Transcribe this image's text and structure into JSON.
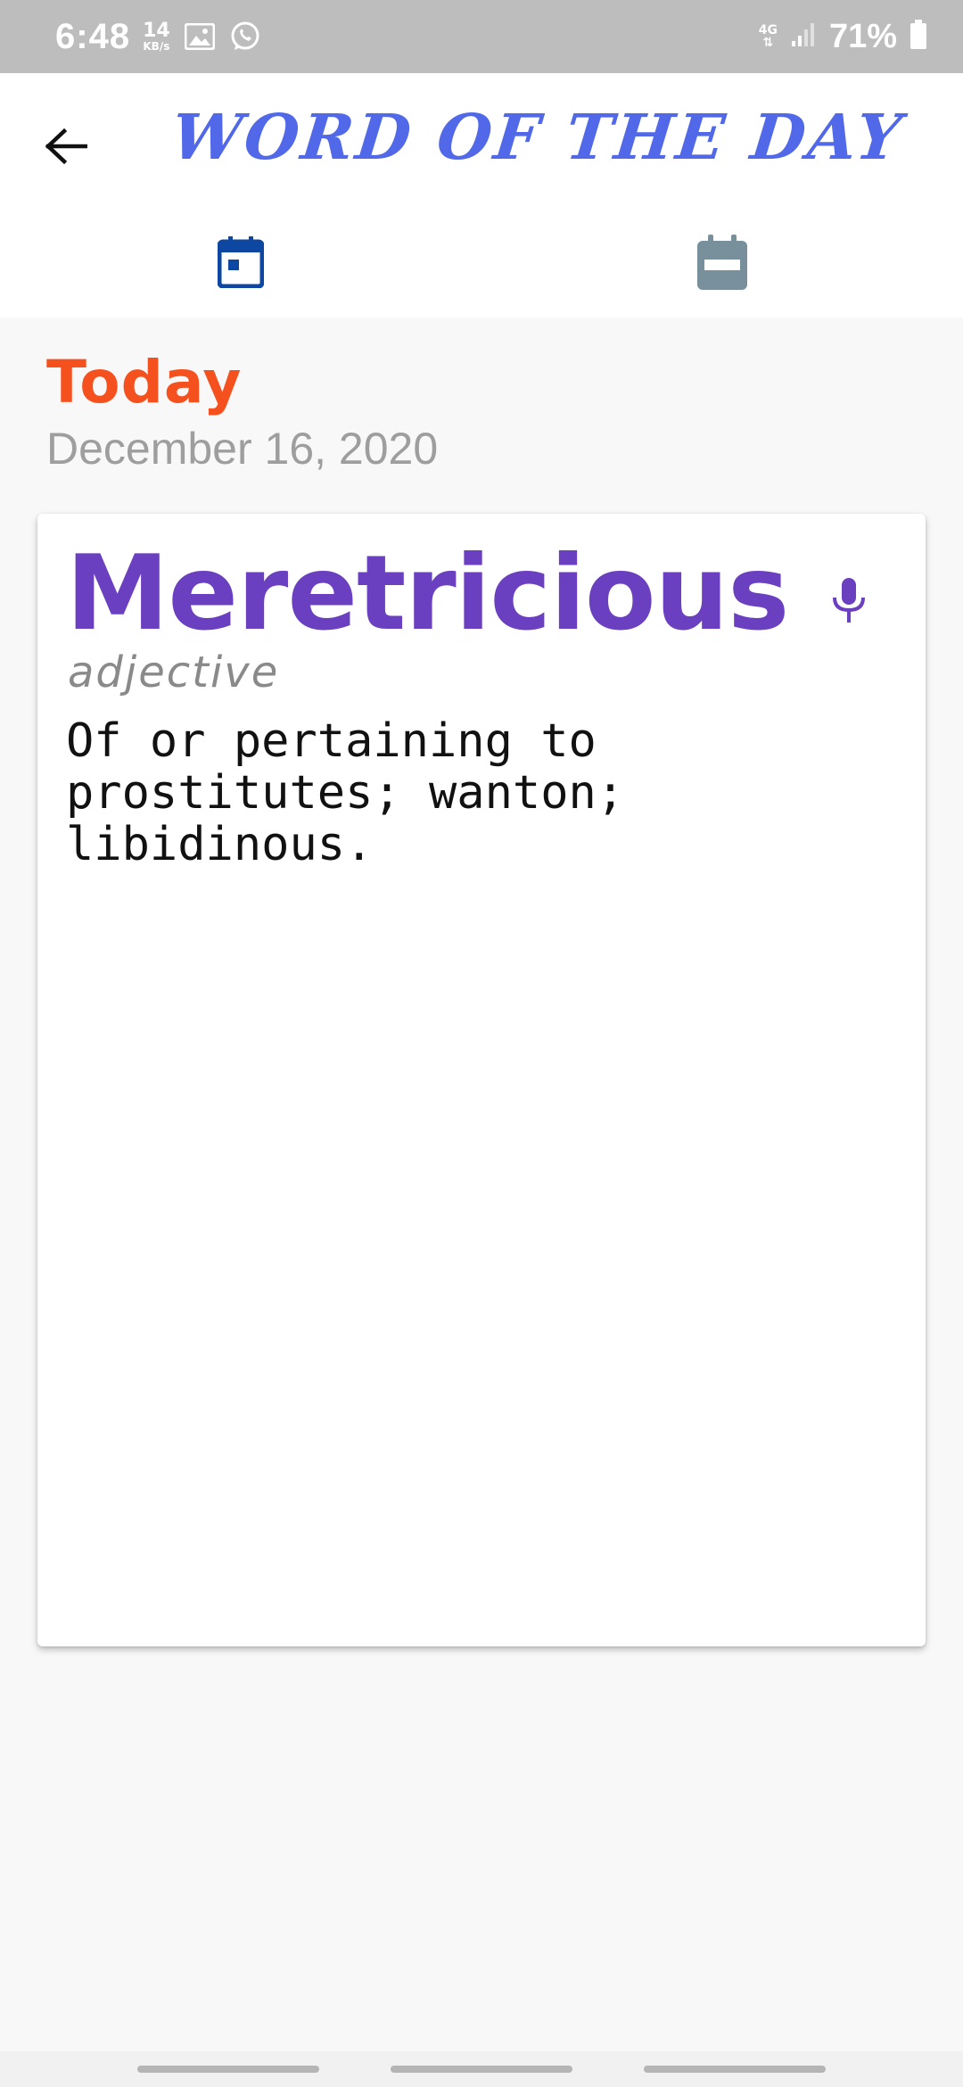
{
  "status_bar": {
    "time": "6:48",
    "speed_value": "14",
    "speed_unit": "KB/s",
    "network": "4G",
    "battery": "71%"
  },
  "header": {
    "title": "WORD OF THE DAY",
    "back_icon": "arrow-left-icon",
    "tabs": [
      {
        "icon": "calendar-today-icon",
        "active": true
      },
      {
        "icon": "calendar-icon",
        "active": false
      }
    ]
  },
  "day": {
    "label": "Today",
    "date": "December 16, 2020"
  },
  "entry": {
    "word": "Meretricious",
    "part_of_speech": "adjective",
    "definition": "Of or pertaining to prostitutes; wanton; libidinous.",
    "action_icon": "microphone-icon"
  },
  "colors": {
    "title": "#5168e8",
    "today": "#f4511e",
    "word": "#6a3fc0",
    "tab_active": "#0d47a1",
    "tab_inactive": "#78909c"
  }
}
